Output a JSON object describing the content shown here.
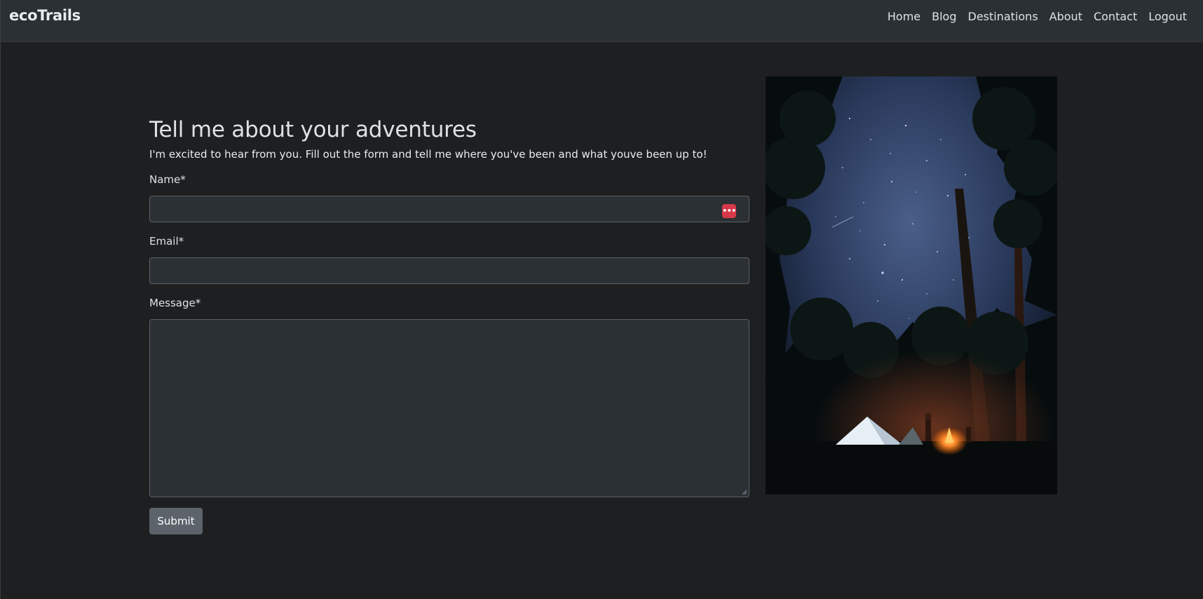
{
  "navbar": {
    "brand": "ecoTrails",
    "links": [
      "Home",
      "Blog",
      "Destinations",
      "About",
      "Contact",
      "Logout"
    ]
  },
  "form": {
    "title": "Tell me about your adventures",
    "intro": "I'm excited to hear from you. Fill out the form and tell me where you've been and what youve been up to!",
    "name_label": "Name*",
    "name_value": "",
    "email_label": "Email*",
    "email_value": "",
    "message_label": "Message*",
    "message_value": "",
    "submit_label": "Submit",
    "password_manager_icon": "ellipsis-key-icon"
  },
  "photo": {
    "subject": "starry-night-campsite-image"
  },
  "colors": {
    "background": "#1e1f21",
    "navbar": "#2b3035",
    "input_bg": "#2b3035",
    "input_border": "#5c6166",
    "button": "#5c636a",
    "password_icon": "#d63a4a"
  }
}
